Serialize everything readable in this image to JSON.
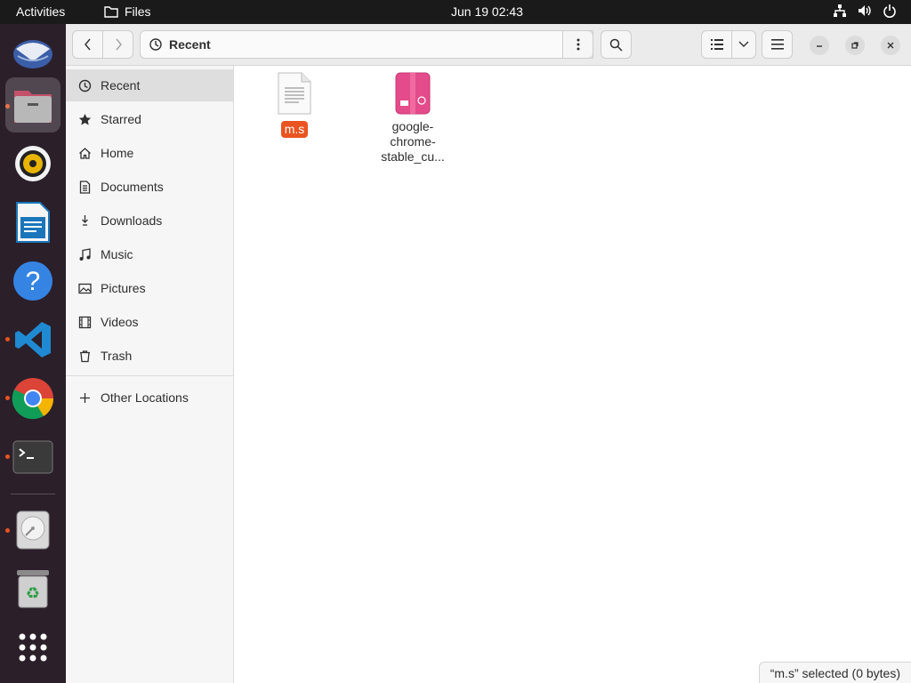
{
  "topbar": {
    "activities": "Activities",
    "app_name": "Files",
    "clock": "Jun 19  02:43",
    "tray_icons": [
      "network-icon",
      "volume-icon",
      "power-icon"
    ]
  },
  "dock": {
    "items": [
      {
        "name": "thunderbird",
        "running": false
      },
      {
        "name": "files",
        "running": true,
        "active": true
      },
      {
        "name": "rhythmbox",
        "running": false
      },
      {
        "name": "libreoffice-writer",
        "running": false
      },
      {
        "name": "help",
        "running": false
      },
      {
        "name": "vscode",
        "running": true
      },
      {
        "name": "chrome",
        "running": true
      },
      {
        "name": "terminal",
        "running": true
      },
      {
        "name": "disk",
        "running": true
      },
      {
        "name": "trash",
        "running": false
      },
      {
        "name": "show-apps",
        "running": false
      }
    ]
  },
  "header": {
    "location": "Recent"
  },
  "sidebar": {
    "items": [
      {
        "label": "Recent",
        "icon": "clock-icon",
        "selected": true
      },
      {
        "label": "Starred",
        "icon": "star-icon"
      },
      {
        "label": "Home",
        "icon": "home-icon"
      },
      {
        "label": "Documents",
        "icon": "document-icon"
      },
      {
        "label": "Downloads",
        "icon": "download-icon"
      },
      {
        "label": "Music",
        "icon": "music-icon"
      },
      {
        "label": "Pictures",
        "icon": "picture-icon"
      },
      {
        "label": "Videos",
        "icon": "video-icon"
      },
      {
        "label": "Trash",
        "icon": "trash-icon"
      }
    ],
    "other_locations": "Other Locations"
  },
  "files": [
    {
      "name": "m.s",
      "type": "text",
      "selected": true
    },
    {
      "name": "google-chrome-stable_cu...",
      "name_lines": [
        "google-",
        "chrome-",
        "stable_cu..."
      ],
      "type": "deb"
    }
  ],
  "status": "“m.s” selected  (0 bytes)",
  "colors": {
    "accent": "#e95420",
    "dock_bg": "#2b1f2a",
    "topbar_bg": "#1a1a1a"
  }
}
